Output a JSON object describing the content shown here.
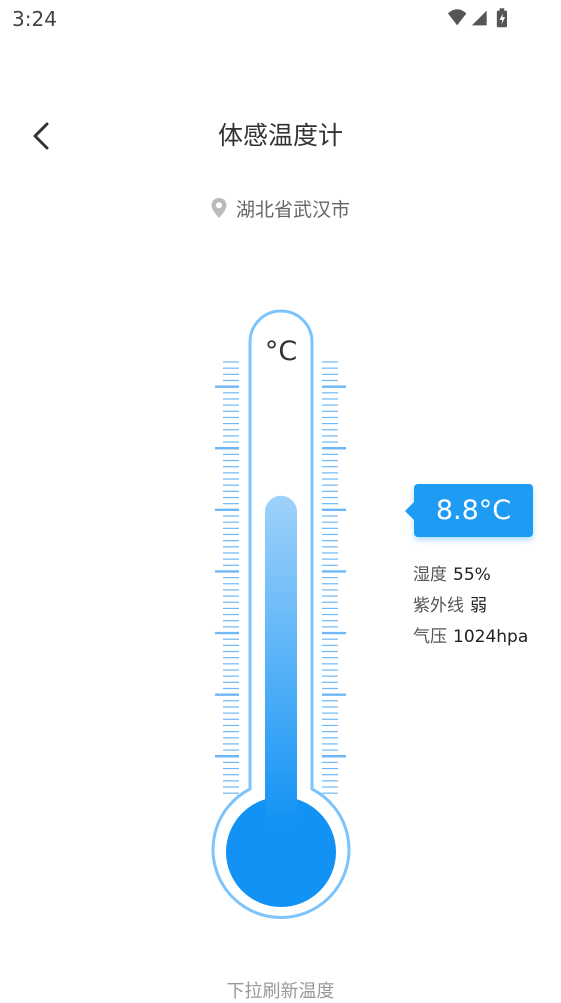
{
  "status_bar": {
    "time": "3:24",
    "icons": [
      "wifi-icon",
      "signal-icon",
      "battery-charging-icon"
    ]
  },
  "header": {
    "title": "体感温度计",
    "back_icon": "chevron-left-icon"
  },
  "location": {
    "icon": "map-pin-icon",
    "text": "湖北省武汉市"
  },
  "thermometer": {
    "unit": "°C",
    "fill_fraction": 0.55,
    "colors": {
      "outline": "#7cc4fb",
      "fill_top": "#9fd2fb",
      "fill_bottom": "#1192f4",
      "ticks": "#6fb8f5"
    }
  },
  "reading": {
    "temperature": "8.8°C",
    "humidity_label": "湿度",
    "humidity_value": "55%",
    "uv_label": "紫外线",
    "uv_value": "弱",
    "pressure_label": "气压",
    "pressure_value": "1024hpa"
  },
  "footer": {
    "hint": "下拉刷新温度"
  },
  "colors": {
    "accent": "#1e9bf3"
  }
}
